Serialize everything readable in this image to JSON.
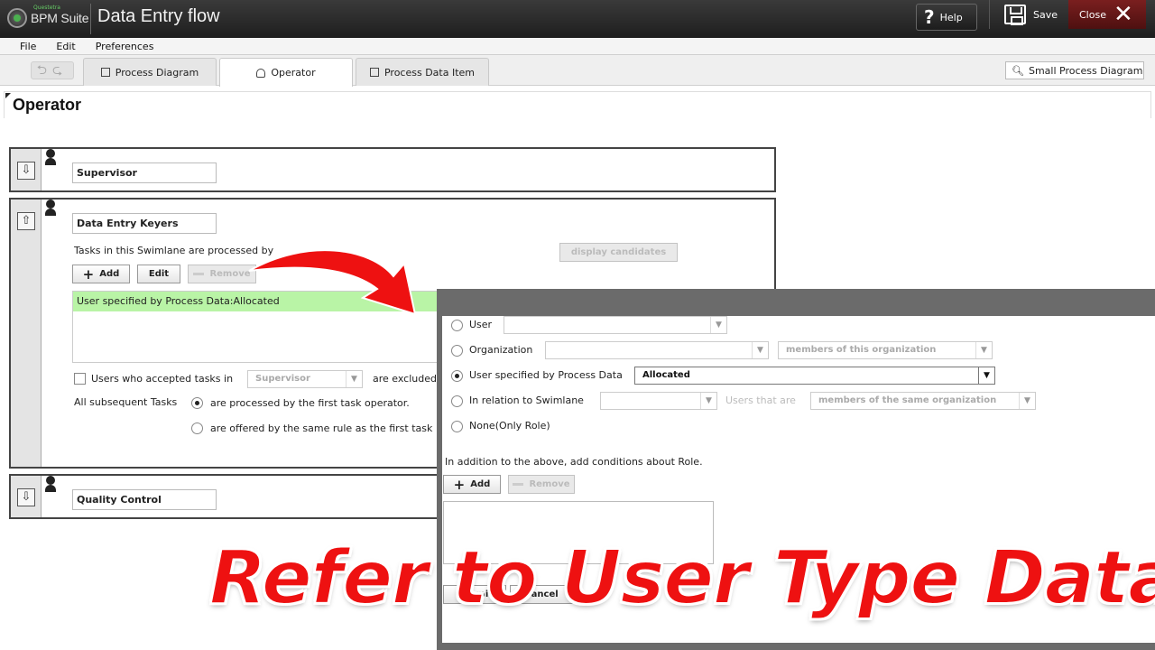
{
  "header": {
    "logo_text": "BPM Suite",
    "logo_sup": "Questetra",
    "app_title": "Data Entry flow",
    "help_label": "Help",
    "save_label": "Save",
    "close_label": "Close"
  },
  "menu": [
    "File",
    "Edit",
    "Preferences"
  ],
  "tabs": [
    {
      "label": "Process Diagram"
    },
    {
      "label": "Operator"
    },
    {
      "label": "Process Data Item"
    }
  ],
  "small_diagram_label": "Small Process Diagram",
  "page_title": "Operator",
  "lanes": {
    "supervisor": "Supervisor",
    "keyers": "Data Entry Keyers",
    "quality": "Quality Control"
  },
  "keyers": {
    "processed_by": "Tasks in this Swimlane are processed by",
    "display_candidates": "display candidates",
    "add_label": "Add",
    "edit_label": "Edit",
    "remove_label": "Remove",
    "rule_item": "User specified by Process Data:Allocated",
    "users_accepted": "Users who accepted tasks in",
    "users_accepted_select": "Supervisor",
    "are_excluded": "are excluded",
    "all_subsequent": "All subsequent Tasks",
    "opt_first_operator": "are processed by the first task operator.",
    "opt_same_rule": "are offered by the same rule as the first task"
  },
  "dialog": {
    "opt_user": "User",
    "opt_org": "Organization",
    "org_scope": "members of this organization",
    "opt_process_data": "User specified by Process Data",
    "process_data_value": "Allocated",
    "opt_relation": "In relation to Swimlane",
    "users_that_are": "Users that are",
    "relation_scope": "members of the same organization",
    "opt_none": "None(Only Role)",
    "role_note": "In addition to the above, add conditions about Role.",
    "add_label": "Add",
    "remove_label": "Remove",
    "submit_label": "Submit",
    "cancel_label": "Cancel"
  },
  "overlay_text": "Refer to User Type Data",
  "colors": {
    "accent_red": "#ee1111",
    "selected_row": "#b9f4a6",
    "close_bg": "#6a1717"
  }
}
